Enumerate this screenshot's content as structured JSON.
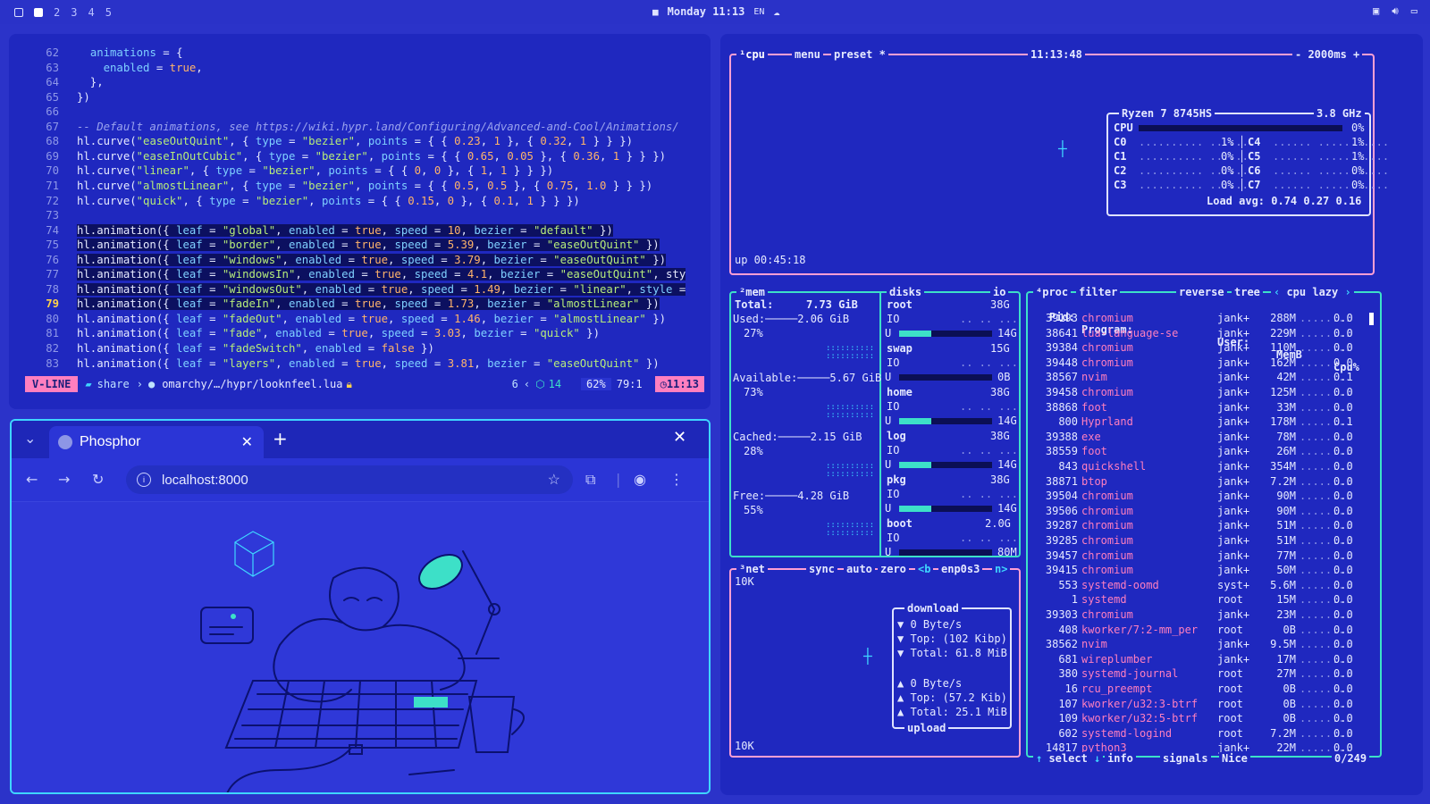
{
  "topbar": {
    "workspaces": [
      "2",
      "3",
      "4",
      "5"
    ],
    "clock": "Monday 11:13",
    "lang": "EN"
  },
  "editor": {
    "lines": [
      {
        "n": "62",
        "t": "  animations = {"
      },
      {
        "n": "63",
        "t": "    enabled = true,"
      },
      {
        "n": "64",
        "t": "  },"
      },
      {
        "n": "65",
        "t": "})"
      },
      {
        "n": "66",
        "t": ""
      },
      {
        "n": "67",
        "t": "-- Default animations, see https://wiki.hypr.land/Configuring/Advanced-and-Cool/Animations/"
      },
      {
        "n": "68",
        "t": "hl.curve(\"easeOutQuint\", { type = \"bezier\", points = { { 0.23, 1 }, { 0.32, 1 } } })"
      },
      {
        "n": "69",
        "t": "hl.curve(\"easeInOutCubic\", { type = \"bezier\", points = { { 0.65, 0.05 }, { 0.36, 1 } } })"
      },
      {
        "n": "70",
        "t": "hl.curve(\"linear\", { type = \"bezier\", points = { { 0, 0 }, { 1, 1 } } })"
      },
      {
        "n": "71",
        "t": "hl.curve(\"almostLinear\", { type = \"bezier\", points = { { 0.5, 0.5 }, { 0.75, 1.0 } } })"
      },
      {
        "n": "72",
        "t": "hl.curve(\"quick\", { type = \"bezier\", points = { { 0.15, 0 }, { 0.1, 1 } } })"
      },
      {
        "n": "73",
        "t": ""
      },
      {
        "n": "74",
        "t": "hl.animation({ leaf = \"global\", enabled = true, speed = 10, bezier = \"default\" })"
      },
      {
        "n": "75",
        "t": "hl.animation({ leaf = \"border\", enabled = true, speed = 5.39, bezier = \"easeOutQuint\" })"
      },
      {
        "n": "76",
        "t": "hl.animation({ leaf = \"windows\", enabled = true, speed = 3.79, bezier = \"easeOutQuint\" })"
      },
      {
        "n": "77",
        "t": "hl.animation({ leaf = \"windowsIn\", enabled = true, speed = 4.1, bezier = \"easeOutQuint\", sty"
      },
      {
        "n": "78",
        "t": "hl.animation({ leaf = \"windowsOut\", enabled = true, speed = 1.49, bezier = \"linear\", style ="
      },
      {
        "n": "79",
        "t": "hl.animation({ leaf = \"fadeIn\", enabled = true, speed = 1.73, bezier = \"almostLinear\" })"
      },
      {
        "n": "80",
        "t": "hl.animation({ leaf = \"fadeOut\", enabled = true, speed = 1.46, bezier = \"almostLinear\" })"
      },
      {
        "n": "81",
        "t": "hl.animation({ leaf = \"fade\", enabled = true, speed = 3.03, bezier = \"quick\" })"
      },
      {
        "n": "82",
        "t": "hl.animation({ leaf = \"fadeSwitch\", enabled = false })"
      },
      {
        "n": "83",
        "t": "hl.animation({ leaf = \"layers\", enabled = true, speed = 3.81, bezier = \"easeOutQuint\" })"
      }
    ],
    "status": {
      "mode": "V-LINE",
      "dir": "share",
      "file": "omarchy/…/hypr/looknfeel.lua",
      "sel_count": "6",
      "lsp": "14",
      "percent": "62%",
      "pos": "79:1",
      "time": "11:13"
    }
  },
  "browser": {
    "tab_title": "Phosphor",
    "url": "localhost:8000"
  },
  "btop": {
    "cpu_box": {
      "tab": "cpu",
      "menu": "menu",
      "preset": "preset *",
      "clock": "11:13:48",
      "interval": "2000ms",
      "uptime": "up 00:45:18"
    },
    "cpu_info": {
      "model": "Ryzen 7 8745HS",
      "freq": "3.8 GHz",
      "total_label": "CPU",
      "total": "0%",
      "cores": [
        {
          "l": "C0",
          "v": "1%",
          "r": "C4",
          "rv": "1%"
        },
        {
          "l": "C1",
          "v": "0%",
          "r": "C5",
          "rv": "1%"
        },
        {
          "l": "C2",
          "v": "0%",
          "r": "C6",
          "rv": "0%"
        },
        {
          "l": "C3",
          "v": "0%",
          "r": "C7",
          "rv": "0%"
        }
      ],
      "loadavg": "Load avg: 0.74 0.27 0.16"
    },
    "mem": {
      "title": "mem",
      "total_label": "Total:",
      "total": "7.73 GiB",
      "items": [
        {
          "label": "Used:",
          "value": "2.06 GiB",
          "pct": "27%"
        },
        {
          "label": "Available:",
          "value": "5.67 GiB",
          "pct": "73%"
        },
        {
          "label": "Cached:",
          "value": "2.15 GiB",
          "pct": "28%"
        },
        {
          "label": "Free:",
          "value": "4.28 GiB",
          "pct": "55%"
        }
      ]
    },
    "disks": {
      "title": "disks",
      "io": "io",
      "items": [
        {
          "name": "root",
          "size": "38G",
          "used": "14G",
          "fill": 0.35
        },
        {
          "name": "swap",
          "size": "15G",
          "used": "0B",
          "fill": 0.0
        },
        {
          "name": "home",
          "size": "38G",
          "used": "14G",
          "fill": 0.35
        },
        {
          "name": "log",
          "size": "38G",
          "used": "14G",
          "fill": 0.35
        },
        {
          "name": "pkg",
          "size": "38G",
          "used": "14G",
          "fill": 0.35
        },
        {
          "name": "boot",
          "size": "2.0G",
          "used": "80M",
          "fill": 0.0
        }
      ]
    },
    "net": {
      "title": "net",
      "sync": "sync",
      "auto": "auto",
      "zero": "zero",
      "iface_prefix": "<b",
      "iface": "enp0s3",
      "iface_suffix": "n>",
      "scale_top": "10K",
      "scale_bottom": "10K",
      "download_label": "download",
      "down": [
        "▼ 0 Byte/s",
        "▼ Top: (102 Kibp)",
        "▼ Total: 61.8 MiB"
      ],
      "up": [
        "▲ 0 Byte/s",
        "▲ Top: (57.2 Kib)",
        "▲ Total: 25.1 MiB"
      ],
      "upload_label": "upload"
    },
    "proc": {
      "title": "proc",
      "filter": "filter",
      "reverse": "reverse",
      "tree": "tree",
      "sort": "cpu lazy",
      "headers": {
        "pid": "Pid:",
        "program": "Program:",
        "user": "User:",
        "mem": "MemB",
        "cpu": "Cpu%"
      },
      "rows": [
        {
          "pid": "39193",
          "prog": "chromium",
          "user": "jank+",
          "mem": "288M",
          "cpu": "0.0"
        },
        {
          "pid": "38641",
          "prog": "lua-language-se",
          "user": "jank+",
          "mem": "229M",
          "cpu": "0.0"
        },
        {
          "pid": "39384",
          "prog": "chromium",
          "user": "jank+",
          "mem": "110M",
          "cpu": "0.0"
        },
        {
          "pid": "39448",
          "prog": "chromium",
          "user": "jank+",
          "mem": "162M",
          "cpu": "0.0"
        },
        {
          "pid": "38567",
          "prog": "nvim",
          "user": "jank+",
          "mem": "42M",
          "cpu": "0.1"
        },
        {
          "pid": "39458",
          "prog": "chromium",
          "user": "jank+",
          "mem": "125M",
          "cpu": "0.0"
        },
        {
          "pid": "38868",
          "prog": "foot",
          "user": "jank+",
          "mem": "33M",
          "cpu": "0.0"
        },
        {
          "pid": "800",
          "prog": "Hyprland",
          "user": "jank+",
          "mem": "178M",
          "cpu": "0.1"
        },
        {
          "pid": "39388",
          "prog": "exe",
          "user": "jank+",
          "mem": "78M",
          "cpu": "0.0"
        },
        {
          "pid": "38559",
          "prog": "foot",
          "user": "jank+",
          "mem": "26M",
          "cpu": "0.0"
        },
        {
          "pid": "843",
          "prog": "quickshell",
          "user": "jank+",
          "mem": "354M",
          "cpu": "0.0"
        },
        {
          "pid": "38871",
          "prog": "btop",
          "user": "jank+",
          "mem": "7.2M",
          "cpu": "0.0"
        },
        {
          "pid": "39504",
          "prog": "chromium",
          "user": "jank+",
          "mem": "90M",
          "cpu": "0.0"
        },
        {
          "pid": "39506",
          "prog": "chromium",
          "user": "jank+",
          "mem": "90M",
          "cpu": "0.0"
        },
        {
          "pid": "39287",
          "prog": "chromium",
          "user": "jank+",
          "mem": "51M",
          "cpu": "0.0"
        },
        {
          "pid": "39285",
          "prog": "chromium",
          "user": "jank+",
          "mem": "51M",
          "cpu": "0.0"
        },
        {
          "pid": "39457",
          "prog": "chromium",
          "user": "jank+",
          "mem": "77M",
          "cpu": "0.0"
        },
        {
          "pid": "39415",
          "prog": "chromium",
          "user": "jank+",
          "mem": "50M",
          "cpu": "0.0"
        },
        {
          "pid": "553",
          "prog": "systemd-oomd",
          "user": "syst+",
          "mem": "5.6M",
          "cpu": "0.0"
        },
        {
          "pid": "1",
          "prog": "systemd",
          "user": "root",
          "mem": "15M",
          "cpu": "0.0"
        },
        {
          "pid": "39303",
          "prog": "chromium",
          "user": "jank+",
          "mem": "23M",
          "cpu": "0.0"
        },
        {
          "pid": "408",
          "prog": "kworker/7:2-mm_per",
          "user": "root",
          "mem": "0B",
          "cpu": "0.0"
        },
        {
          "pid": "38562",
          "prog": "nvim",
          "user": "jank+",
          "mem": "9.5M",
          "cpu": "0.0"
        },
        {
          "pid": "681",
          "prog": "wireplumber",
          "user": "jank+",
          "mem": "17M",
          "cpu": "0.0"
        },
        {
          "pid": "380",
          "prog": "systemd-journal",
          "user": "root",
          "mem": "27M",
          "cpu": "0.0"
        },
        {
          "pid": "16",
          "prog": "rcu_preempt",
          "user": "root",
          "mem": "0B",
          "cpu": "0.0"
        },
        {
          "pid": "107",
          "prog": "kworker/u32:3-btrf",
          "user": "root",
          "mem": "0B",
          "cpu": "0.0"
        },
        {
          "pid": "109",
          "prog": "kworker/u32:5-btrf",
          "user": "root",
          "mem": "0B",
          "cpu": "0.0"
        },
        {
          "pid": "602",
          "prog": "systemd-logind",
          "user": "root",
          "mem": "7.2M",
          "cpu": "0.0"
        },
        {
          "pid": "14817",
          "prog": "python3",
          "user": "jank+",
          "mem": "22M",
          "cpu": "0.0"
        }
      ],
      "footer": {
        "select": "select",
        "info": "info",
        "signals": "signals",
        "nice": "Nice",
        "count": "0/249"
      }
    }
  }
}
